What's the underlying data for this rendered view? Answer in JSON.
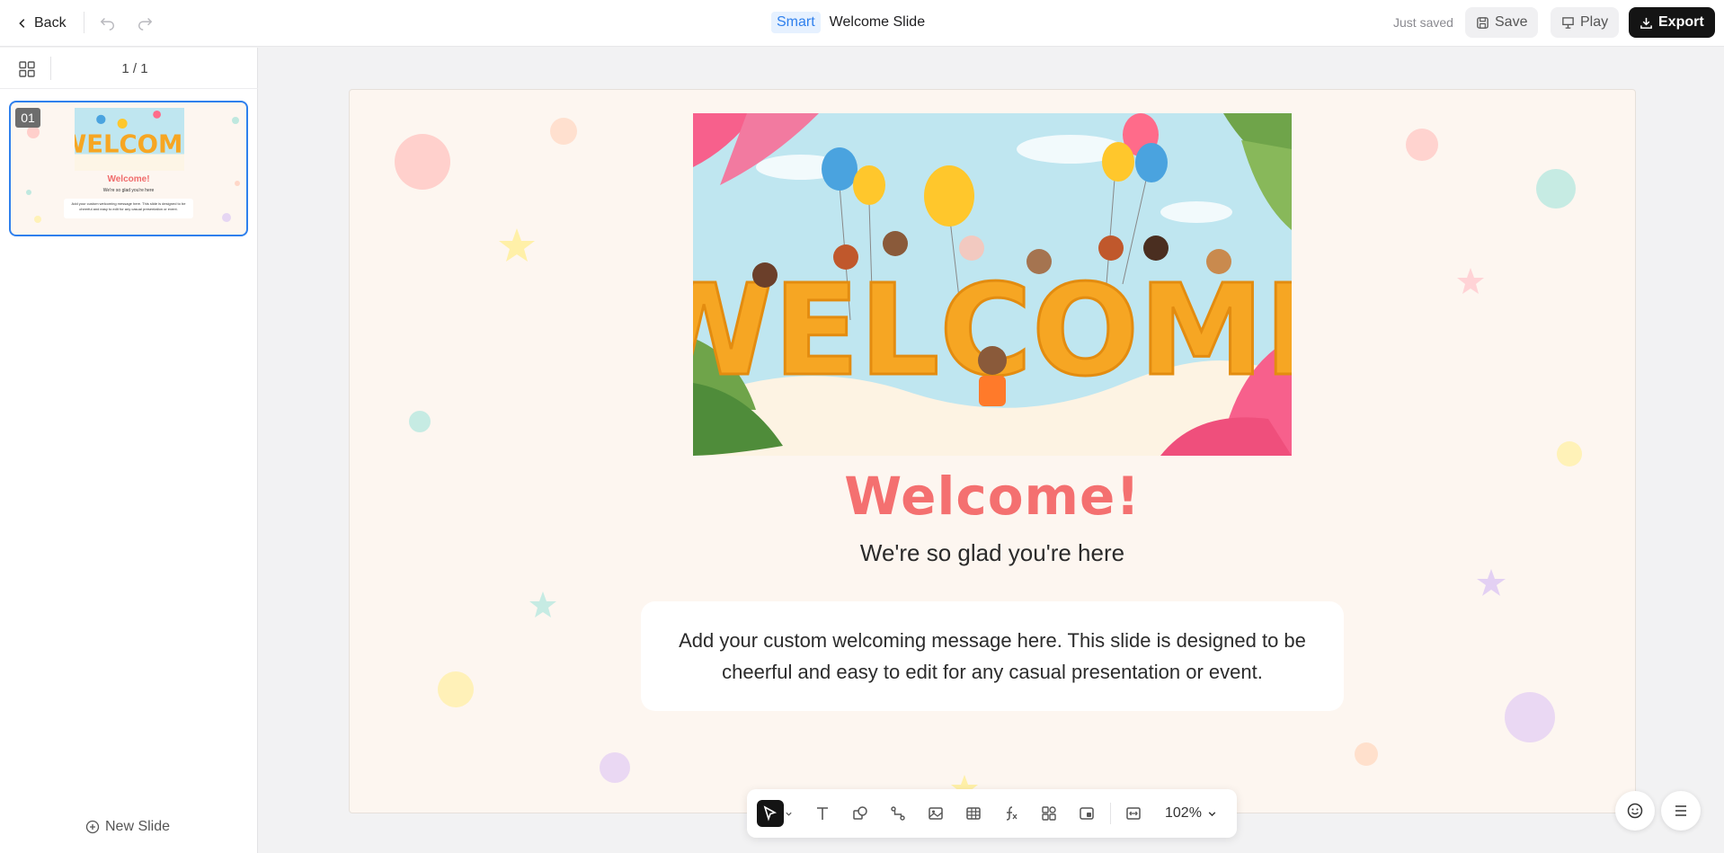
{
  "topbar": {
    "back_label": "Back",
    "badge": "Smart",
    "title": "Welcome Slide",
    "status": "Just saved",
    "save_label": "Save",
    "play_label": "Play",
    "export_label": "Export"
  },
  "sidebar": {
    "page_counter": "1 / 1",
    "thumbnail": {
      "number": "01",
      "title": "Welcome!",
      "subtitle": "We're so glad you're here",
      "message": "Add your custom welcoming message here. This slide is designed to be cheerful and easy to edit for any casual presentation or event."
    },
    "new_slide_label": "New Slide"
  },
  "slide": {
    "image_text": "WELCOME",
    "title": "Welcome!",
    "subtitle": "We're so glad you're here",
    "message": "Add your custom welcoming message here. This slide is designed to be cheerful and easy to edit for any casual presentation or event."
  },
  "toolbar": {
    "tools": [
      "select-tool",
      "text-tool",
      "shape-tool",
      "connector-tool",
      "image-tool",
      "table-tool",
      "formula-tool",
      "components-tool",
      "embed-tool",
      "fit-tool"
    ],
    "zoom": "102%"
  },
  "colors": {
    "accent": "#2f80ed",
    "title": "#f47070",
    "slide_bg": "#fdf6f0",
    "export_bg": "#141414"
  }
}
